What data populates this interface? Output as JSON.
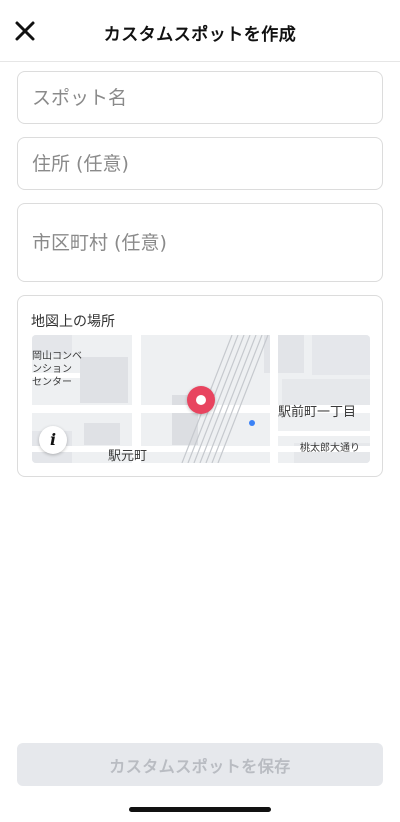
{
  "header": {
    "title": "カスタムスポットを作成",
    "close_icon": "close-icon"
  },
  "form": {
    "name_placeholder": "スポット名",
    "address_placeholder": "住所 (任意)",
    "city_placeholder": "市区町村 (任意)"
  },
  "map": {
    "label": "地図上の場所",
    "places": {
      "convention": [
        "岡山コンベ",
        "ンション",
        "センター"
      ],
      "ekimae": "駅前町一丁目",
      "momotaro": "桃太郎大通り",
      "ekimoto": "駅元町"
    },
    "info_glyph": "i",
    "pin_color": "#e8445f"
  },
  "footer": {
    "save_label": "カスタムスポットを保存"
  }
}
